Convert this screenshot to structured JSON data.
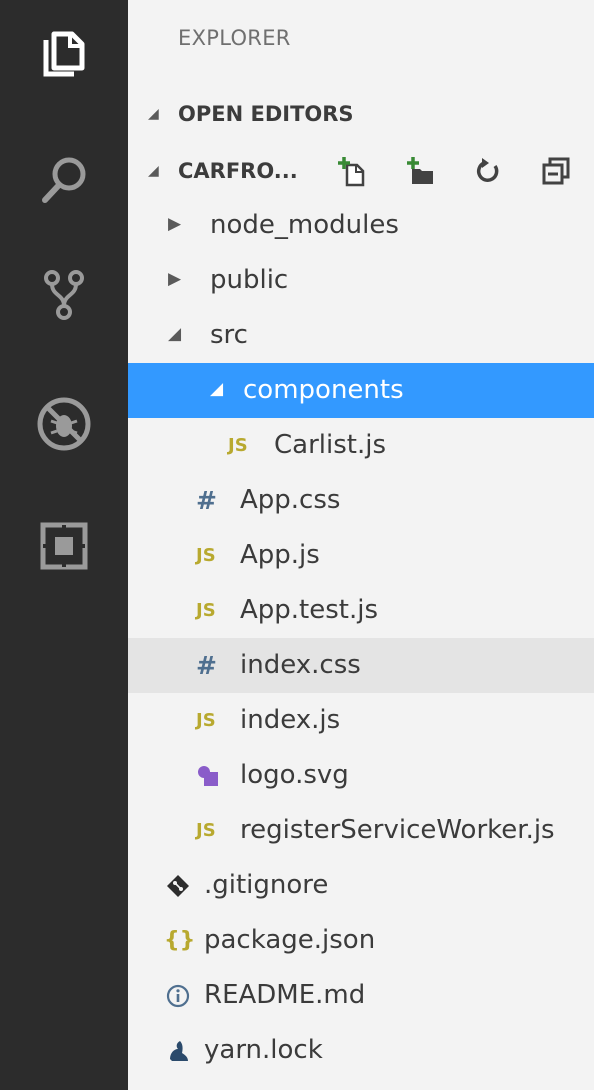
{
  "activity_bar": {
    "items": [
      {
        "name": "explorer",
        "icon": "files-icon"
      },
      {
        "name": "search",
        "icon": "search-icon"
      },
      {
        "name": "source-control",
        "icon": "source-control-icon"
      },
      {
        "name": "debug",
        "icon": "debug-icon"
      },
      {
        "name": "extensions",
        "icon": "extensions-icon"
      }
    ]
  },
  "sidebar": {
    "title": "EXPLORER",
    "sections": {
      "open_editors": {
        "label": "OPEN EDITORS"
      },
      "project": {
        "label": "CARFRO..."
      }
    },
    "toolbar": {
      "new_file_icon": "new-file-icon",
      "new_folder_icon": "new-folder-icon",
      "refresh_icon": "refresh-icon",
      "collapse_icon": "collapse-all-icon"
    },
    "tree": [
      {
        "label": "node_modules",
        "kind": "folder-collapsed"
      },
      {
        "label": "public",
        "kind": "folder-collapsed"
      },
      {
        "label": "src",
        "kind": "folder-expanded"
      },
      {
        "label": "components",
        "kind": "folder-expanded",
        "selected": true
      },
      {
        "label": "Carlist.js",
        "icon_text": "JS"
      },
      {
        "label": "App.css",
        "icon_text": "#"
      },
      {
        "label": "App.js",
        "icon_text": "JS"
      },
      {
        "label": "App.test.js",
        "icon_text": "JS"
      },
      {
        "label": "index.css",
        "icon_text": "#",
        "hovered": true
      },
      {
        "label": "index.js",
        "icon_text": "JS"
      },
      {
        "label": "logo.svg",
        "icon": "svg-file-icon"
      },
      {
        "label": "registerServiceWorker.js",
        "icon_text": "JS"
      },
      {
        "label": ".gitignore",
        "icon": "git-icon"
      },
      {
        "label": "package.json",
        "icon_text": "{}"
      },
      {
        "label": "README.md",
        "icon": "info-icon"
      },
      {
        "label": "yarn.lock",
        "icon": "yarn-icon"
      }
    ]
  },
  "colors": {
    "activity_bar_bg": "#2c2c2c",
    "sidebar_bg": "#f3f3f3",
    "selection": "#3399ff",
    "hover": "#e4e4e4",
    "js_icon": "#b8a92f",
    "css_icon": "#4f6f8f"
  }
}
